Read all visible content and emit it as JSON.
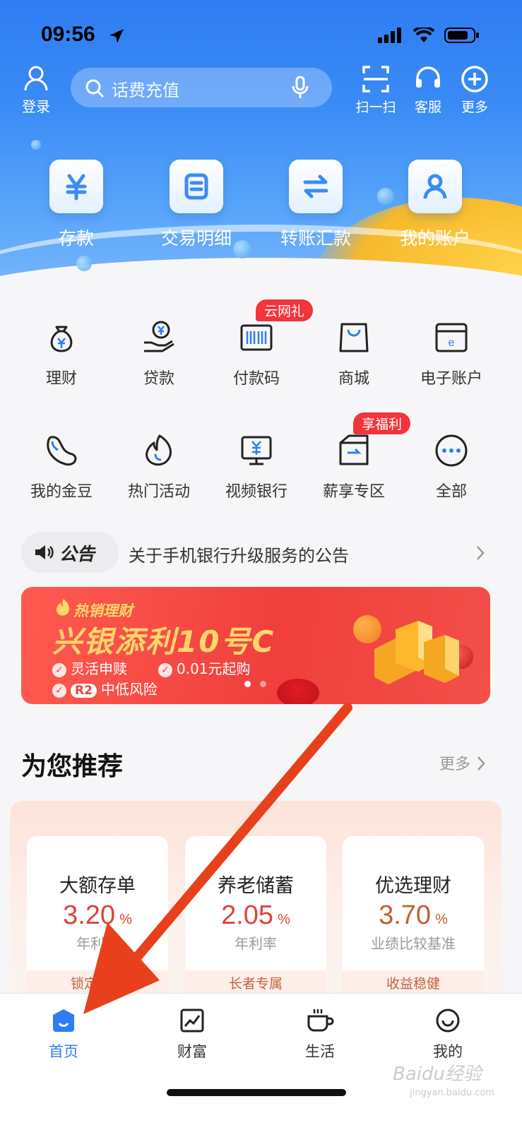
{
  "status_bar": {
    "time": "09:56"
  },
  "header": {
    "login_label": "登录",
    "search_placeholder": "话费充值",
    "actions": [
      {
        "label": "扫一扫",
        "icon": "scan-icon"
      },
      {
        "label": "客服",
        "icon": "headset-icon"
      },
      {
        "label": "更多",
        "icon": "plus-circle-icon"
      }
    ],
    "quick_entries": [
      {
        "label": "存款",
        "icon": "yen-icon"
      },
      {
        "label": "交易明细",
        "icon": "document-icon"
      },
      {
        "label": "转账汇款",
        "icon": "transfer-icon"
      },
      {
        "label": "我的账户",
        "icon": "user-icon"
      }
    ]
  },
  "services": {
    "row1": [
      {
        "label": "理财",
        "icon": "money-bag-icon"
      },
      {
        "label": "贷款",
        "icon": "loan-hand-icon"
      },
      {
        "label": "付款码",
        "icon": "barcode-icon",
        "tag": "云网礼"
      },
      {
        "label": "商城",
        "icon": "shopping-bag-icon"
      },
      {
        "label": "电子账户",
        "icon": "e-card-icon"
      }
    ],
    "row2": [
      {
        "label": "我的金豆",
        "icon": "bean-icon"
      },
      {
        "label": "热门活动",
        "icon": "flame-icon"
      },
      {
        "label": "视频银行",
        "icon": "monitor-yen-icon"
      },
      {
        "label": "薪享专区",
        "icon": "salary-box-icon",
        "tag": "享福利"
      },
      {
        "label": "全部",
        "icon": "more-dots-icon"
      }
    ]
  },
  "notice": {
    "title": "公告",
    "text": "关于手机银行升级服务的公告"
  },
  "banner": {
    "hot_label": "热销理财",
    "title": "兴银添利10号C",
    "feature1": "灵活申赎",
    "feature2": "0.01元起购",
    "risk_badge": "R2",
    "risk_text": "中低风险"
  },
  "recommend": {
    "title": "为您推荐",
    "more_label": "更多",
    "cards": [
      {
        "name": "大额存单",
        "rate": "3.20",
        "unit": "%",
        "rate_label": "年利率",
        "footer": "锁定收益"
      },
      {
        "name": "养老储蓄",
        "rate": "2.05",
        "unit": "%",
        "rate_label": "年利率",
        "footer": "长者专属"
      },
      {
        "name": "优选理财",
        "rate": "3.70",
        "unit": "%",
        "rate_label": "业绩比较基准",
        "footer": "收益稳健"
      }
    ]
  },
  "tabbar": {
    "tabs": [
      {
        "label": "首页",
        "icon": "home-icon",
        "active": true
      },
      {
        "label": "财富",
        "icon": "chart-icon",
        "active": false
      },
      {
        "label": "生活",
        "icon": "coffee-cup-icon",
        "active": false
      },
      {
        "label": "我的",
        "icon": "smile-icon",
        "active": false
      }
    ]
  },
  "watermark": {
    "text": "Baidu经验",
    "sub": "jingyan.baidu.com"
  },
  "colors": {
    "primary": "#2f7df2",
    "accent_red": "#f03f3c",
    "gold": "#ffd66b",
    "annotation_arrow": "#e8401c"
  }
}
